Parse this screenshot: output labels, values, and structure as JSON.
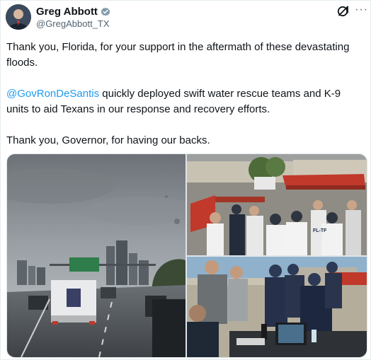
{
  "author": {
    "name": "Greg Abbott",
    "handle": "@GregAbbott_TX"
  },
  "tweet": {
    "line1": "Thank you, Florida, for your support in the aftermath of these devastating floods.",
    "mention": "@GovRonDeSantis",
    "line2_rest": " quickly deployed swift water rescue teams and K-9 units to aid Texans in our response and recovery efforts.",
    "line3": "Thank you, Governor, for having our backs."
  },
  "media": {
    "photo1": {
      "sign_text": ""
    },
    "photo2": {
      "shirt_text": "FL-TF"
    },
    "photo3": {}
  },
  "icons": [
    "verified-icon",
    "grok-icon",
    "more-icon"
  ],
  "colors": {
    "link": "#1d9bf0",
    "verified": "#829aab",
    "text": "#0f1419",
    "secondary": "#536471"
  }
}
